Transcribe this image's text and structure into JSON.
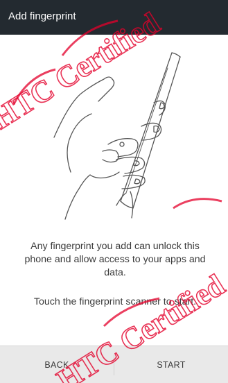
{
  "header": {
    "title": "Add fingerprint"
  },
  "main": {
    "description": "Any fingerprint you add can unlock this phone and allow access to your apps and data.",
    "hint": "Touch the fingerprint scanner to start."
  },
  "footer": {
    "back_label": "BACK",
    "start_label": "START"
  },
  "watermark": {
    "text": "HTC Certified"
  },
  "colors": {
    "titlebar": "#232a30",
    "footer": "#e9e9e9",
    "watermark": "#e4002b"
  },
  "icons": {
    "illustration": "hand-holding-phone-illustration"
  }
}
